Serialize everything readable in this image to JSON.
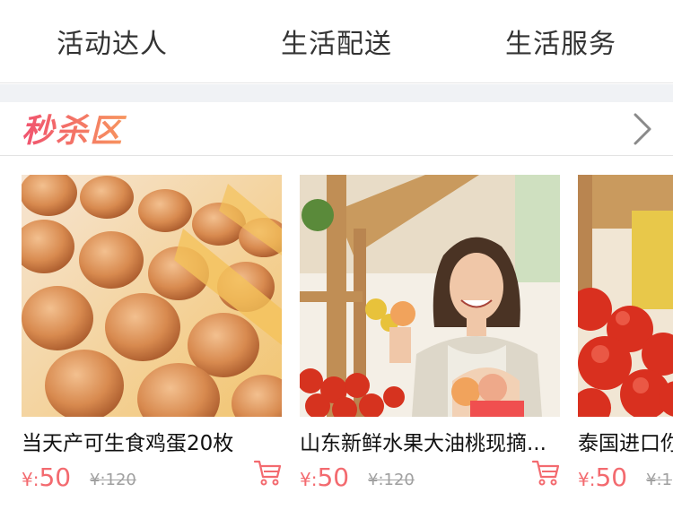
{
  "nav": {
    "items": [
      "活动达人",
      "生活配送",
      "生活服务"
    ]
  },
  "section": {
    "title": "秒杀区",
    "more_icon": "chevron-right-icon"
  },
  "products": [
    {
      "title": "当天产可生食鸡蛋20枚",
      "price": "50",
      "currency": "¥:",
      "old_price": "¥:120",
      "image": "eggs-photo",
      "cart_icon": "cart-icon"
    },
    {
      "title": "山东新鲜水果大油桃现摘...",
      "price": "50",
      "currency": "¥:",
      "old_price": "¥:120",
      "image": "fruit-vendor-photo",
      "cart_icon": "cart-icon"
    },
    {
      "title": "泰国进口你",
      "price": "50",
      "currency": "¥:",
      "old_price": "¥:1",
      "image": "tomatoes-photo",
      "cart_icon": "cart-icon"
    }
  ],
  "colors": {
    "accent": "#f36a6f",
    "nav_text": "#333333",
    "muted": "#a0a0a0",
    "divider": "#e6e6e6"
  }
}
